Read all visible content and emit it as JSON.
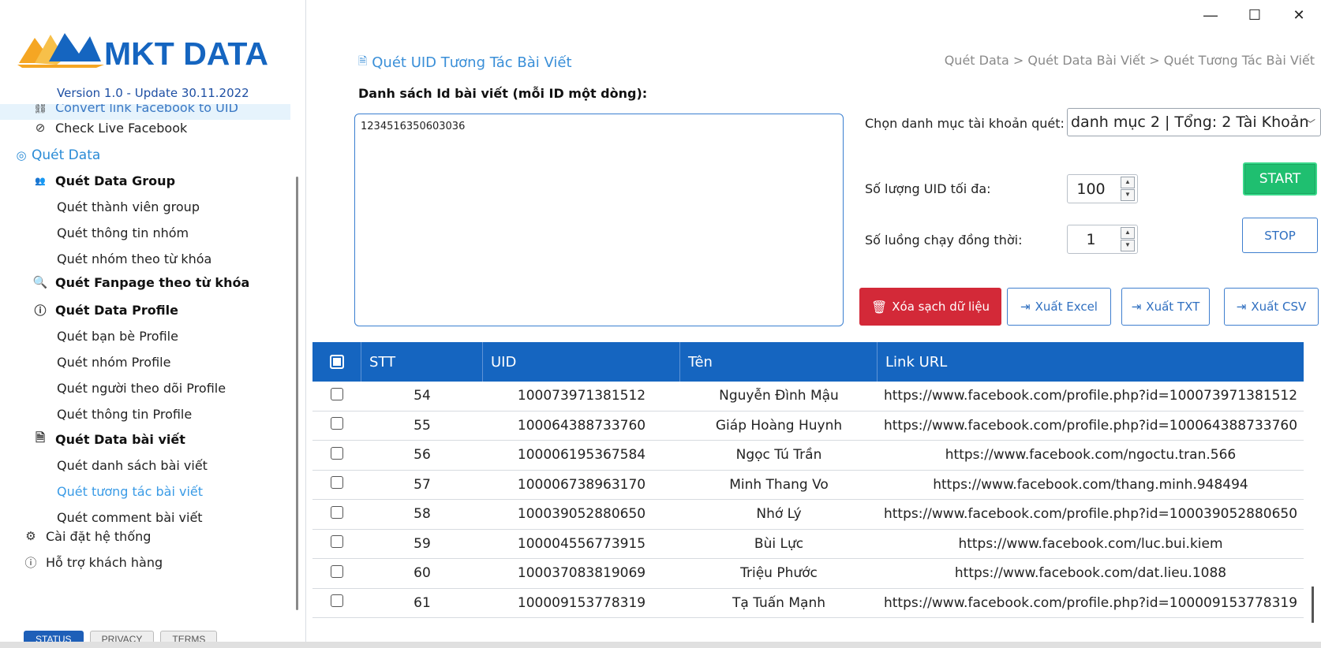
{
  "app": {
    "brand": "MKT DATA",
    "version": "Version 1.0 - Update 30.11.2022",
    "colors": {
      "brand_blue": "#1565c0",
      "brand_orange": "#f5a623",
      "accent": "#3a9be6",
      "start_green": "#1fbf70",
      "danger_red": "#d32938"
    }
  },
  "window_controls": {
    "minimize": "—",
    "maximize": "☐",
    "close": "✕"
  },
  "sidebar": {
    "items": [
      {
        "label": "Convert link Facebook to UID",
        "icon": "link-icon"
      },
      {
        "label": "Check Live Facebook",
        "icon": "check-circle-icon"
      },
      {
        "label": "Quét Data",
        "icon": "target-icon"
      },
      {
        "label": "Quét Data Group",
        "icon": "group-icon"
      },
      {
        "label": "Quét thành viên group"
      },
      {
        "label": "Quét thông tin nhóm"
      },
      {
        "label": "Quét nhóm theo từ khóa"
      },
      {
        "label": "Quét Fanpage theo từ khóa",
        "icon": "search-icon"
      },
      {
        "label": "Quét Data Profile",
        "icon": "profile-icon"
      },
      {
        "label": "Quét bạn bè Profile"
      },
      {
        "label": "Quét nhóm Profile"
      },
      {
        "label": "Quét người theo dõi Profile"
      },
      {
        "label": "Quét thông tin Profile"
      },
      {
        "label": "Quét Data bài viết",
        "icon": "document-icon"
      },
      {
        "label": "Quét danh sách bài viết"
      },
      {
        "label": "Quét tương tác bài viết"
      },
      {
        "label": "Quét comment bài viết"
      },
      {
        "label": "Cài đặt hệ thống",
        "icon": "gear-icon"
      },
      {
        "label": "Hỗ trợ khách hàng",
        "icon": "help-icon"
      }
    ],
    "footer": [
      "STATUS",
      "PRIVACY",
      "TERMS"
    ]
  },
  "main": {
    "title": "Quét UID Tương Tác Bài Viết",
    "breadcrumb": "Quét Data > Quét Data Bài Viết > Quét Tương Tác Bài Viết",
    "id_list_label": "Danh sách Id bài viết (mỗi ID một dòng):",
    "id_list_value": "1234516350603036",
    "category_label": "Chọn danh mục tài khoản quét:",
    "category_value": "danh mục 2 | Tổng: 2 Tài Khoản",
    "max_uid_label": "Số lượng UID tối đa:",
    "max_uid_value": "100",
    "threads_label": "Số luồng chạy đồng thời:",
    "threads_value": "1",
    "start_label": "START",
    "stop_label": "STOP",
    "clear_label": "Xóa sạch dữ liệu",
    "export_excel_label": "Xuất Excel",
    "export_txt_label": "Xuất TXT",
    "export_csv_label": "Xuất CSV"
  },
  "table": {
    "columns": [
      "STT",
      "UID",
      "Tên",
      "Link URL"
    ],
    "rows": [
      {
        "stt": "54",
        "uid": "100073971381512",
        "name": "Nguyễn Đình Mậu",
        "url": "https://www.facebook.com/profile.php?id=100073971381512"
      },
      {
        "stt": "55",
        "uid": "100064388733760",
        "name": "Giáp Hoàng Huynh",
        "url": "https://www.facebook.com/profile.php?id=100064388733760"
      },
      {
        "stt": "56",
        "uid": "100006195367584",
        "name": "Ngọc Tú Trần",
        "url": "https://www.facebook.com/ngoctu.tran.566"
      },
      {
        "stt": "57",
        "uid": "100006738963170",
        "name": "Minh Thang Vo",
        "url": "https://www.facebook.com/thang.minh.948494"
      },
      {
        "stt": "58",
        "uid": "100039052880650",
        "name": "Nhớ Lý",
        "url": "https://www.facebook.com/profile.php?id=100039052880650"
      },
      {
        "stt": "59",
        "uid": "100004556773915",
        "name": "Bùi Lực",
        "url": "https://www.facebook.com/luc.bui.kiem"
      },
      {
        "stt": "60",
        "uid": "100037083819069",
        "name": "Triệu Phước",
        "url": "https://www.facebook.com/dat.lieu.1088"
      },
      {
        "stt": "61",
        "uid": "100009153778319",
        "name": "Tạ Tuấn Mạnh",
        "url": "https://www.facebook.com/profile.php?id=100009153778319"
      }
    ]
  }
}
